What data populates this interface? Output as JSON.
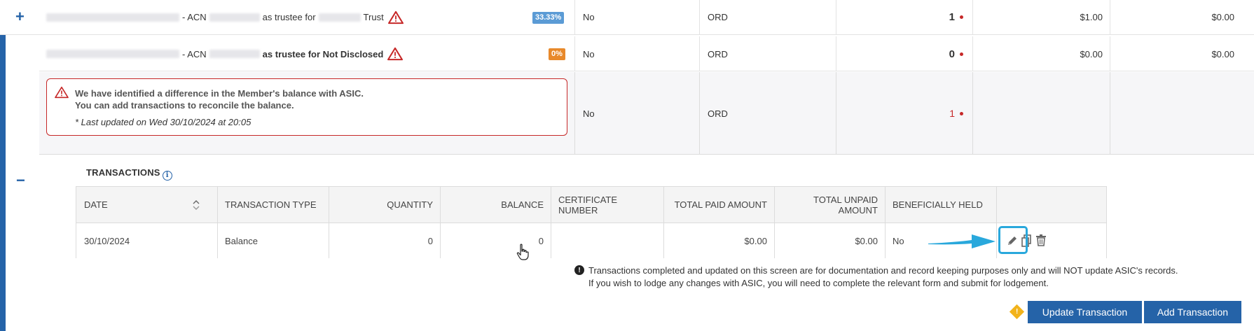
{
  "rows": [
    {
      "toggle": "+",
      "acn_label": "- ACN",
      "trustee_text": "as trustee for",
      "trust_suffix": "Trust",
      "badge": "33.33%",
      "beneficially": "No",
      "class": "ORD",
      "quantity": "1",
      "paid": "$1.00",
      "unpaid": "$0.00"
    },
    {
      "acn_label": "- ACN",
      "trustee_text": "as trustee for Not Disclosed",
      "badge": "0%",
      "beneficially": "No",
      "class": "ORD",
      "quantity": "0",
      "paid": "$0.00",
      "unpaid": "$0.00"
    }
  ],
  "alert": {
    "line1": "We have identified a difference in the Member's balance with ASIC.",
    "line2": "You can add transactions to reconcile the balance.",
    "updated": "* Last updated on Wed 30/10/2024 at 20:05",
    "beneficially": "No",
    "class": "ORD",
    "quantity": "1"
  },
  "transactions": {
    "toggle": "−",
    "title": "TRANSACTIONS",
    "columns": {
      "date": "DATE",
      "type": "TRANSACTION TYPE",
      "quantity": "QUANTITY",
      "balance": "BALANCE",
      "certificate": "CERTIFICATE NUMBER",
      "total_paid": "TOTAL PAID AMOUNT",
      "total_unpaid": "TOTAL UNPAID AMOUNT",
      "beneficially": "BENEFICIALLY HELD"
    },
    "row": {
      "date": "30/10/2024",
      "type": "Balance",
      "quantity": "0",
      "balance": "0",
      "certificate": "",
      "total_paid": "$0.00",
      "total_unpaid": "$0.00",
      "beneficially": "No"
    }
  },
  "note": {
    "line1": "Transactions completed and updated on this screen are for documentation and record keeping purposes only and will NOT update ASIC's records.",
    "line2": "If you wish to lodge any changes with ASIC, you will need to complete the relevant form and submit for lodgement."
  },
  "buttons": {
    "update": "Update Transaction",
    "add": "Add Transaction"
  },
  "colors": {
    "brand_blue": "#2563a8",
    "badge_blue": "#5b9bd5",
    "badge_orange": "#e8892b",
    "alert_red": "#c62828",
    "highlight": "#29a8dc"
  },
  "icons": [
    "plus-icon",
    "minus-icon",
    "warning-icon",
    "info-icon",
    "sort-icon",
    "edit-icon",
    "copy-icon",
    "trash-icon",
    "arrow-pointer",
    "cursor-hand-icon",
    "alert-diamond-icon"
  ]
}
